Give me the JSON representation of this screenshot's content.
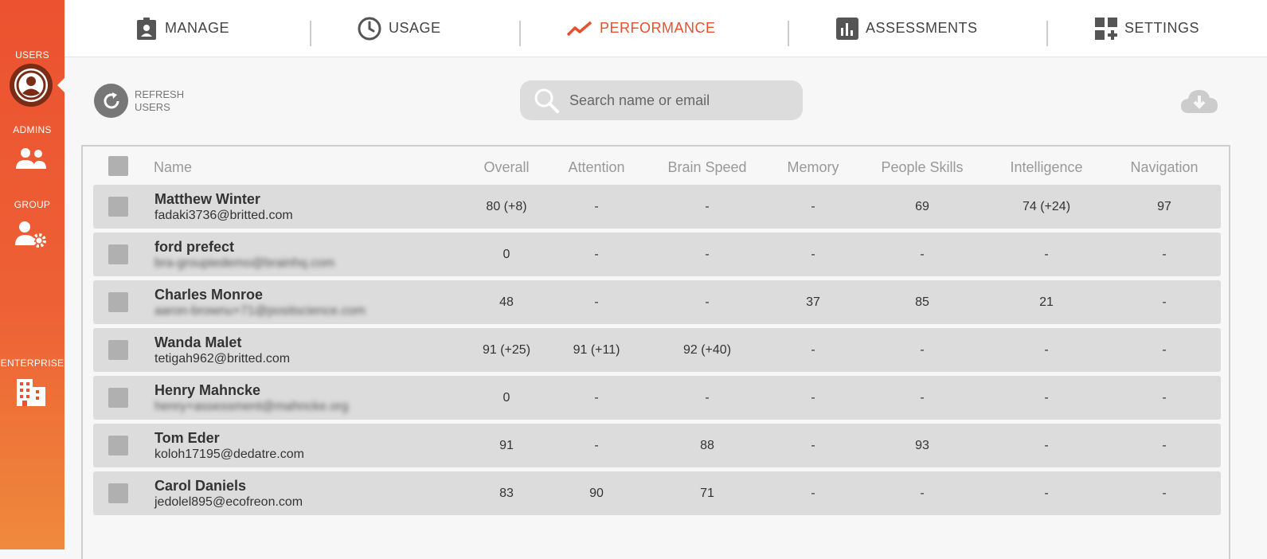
{
  "sidebar": {
    "items": [
      {
        "label": "USERS",
        "icon": "user-circle-icon",
        "active": true
      },
      {
        "label": "ADMINS",
        "icon": "people-icon"
      },
      {
        "label": "GROUP",
        "icon": "user-gear-icon"
      },
      {
        "label": "ENTERPRISE",
        "icon": "building-icon"
      }
    ]
  },
  "nav": {
    "tabs": [
      {
        "label": "MANAGE",
        "icon": "clipboard-user-icon"
      },
      {
        "label": "USAGE",
        "icon": "clock-icon"
      },
      {
        "label": "PERFORMANCE",
        "icon": "trend-line-icon",
        "active": true
      },
      {
        "label": "ASSESSMENTS",
        "icon": "bar-chart-icon"
      },
      {
        "label": "SETTINGS",
        "icon": "grid-plus-icon"
      }
    ]
  },
  "toolbar": {
    "refresh_label_1": "REFRESH",
    "refresh_label_2": "USERS",
    "search_placeholder": "Search name or email",
    "download_icon": "cloud-download-icon"
  },
  "colors": {
    "accent": "#e8502d",
    "sidebar": "#ec5230",
    "row_bg": "#dcdcdc"
  },
  "table": {
    "columns": [
      "Name",
      "Overall",
      "Attention",
      "Brain Speed",
      "Memory",
      "People Skills",
      "Intelligence",
      "Navigation"
    ],
    "rows": [
      {
        "name": "Matthew Winter",
        "email": "fadaki3736@britted.com",
        "email_blurred": false,
        "scores": [
          "80 (+8)",
          "-",
          "-",
          "-",
          "69",
          "74 (+24)",
          "97"
        ]
      },
      {
        "name": "ford prefect",
        "email": "bra-groupiedemo@brainhq.com",
        "email_blurred": true,
        "scores": [
          "0",
          "-",
          "-",
          "-",
          "-",
          "-",
          "-"
        ]
      },
      {
        "name": "Charles Monroe",
        "email": "aaron-brownu+71@positscience.com",
        "email_blurred": true,
        "scores": [
          "48",
          "-",
          "-",
          "37",
          "85",
          "21",
          "-"
        ]
      },
      {
        "name": "Wanda Malet",
        "email": "tetigah962@britted.com",
        "email_blurred": false,
        "scores": [
          "91 (+25)",
          "91 (+11)",
          "92 (+40)",
          "-",
          "-",
          "-",
          "-"
        ]
      },
      {
        "name": "Henry Mahncke",
        "email": "henry+assessment@mahncke.org",
        "email_blurred": true,
        "scores": [
          "0",
          "-",
          "-",
          "-",
          "-",
          "-",
          "-"
        ]
      },
      {
        "name": "Tom Eder",
        "email": "koloh17195@dedatre.com",
        "email_blurred": false,
        "scores": [
          "91",
          "-",
          "88",
          "-",
          "93",
          "-",
          "-"
        ]
      },
      {
        "name": "Carol Daniels",
        "email": "jedolel895@ecofreon.com",
        "email_blurred": false,
        "scores": [
          "83",
          "90",
          "71",
          "-",
          "-",
          "-",
          "-"
        ]
      }
    ]
  }
}
